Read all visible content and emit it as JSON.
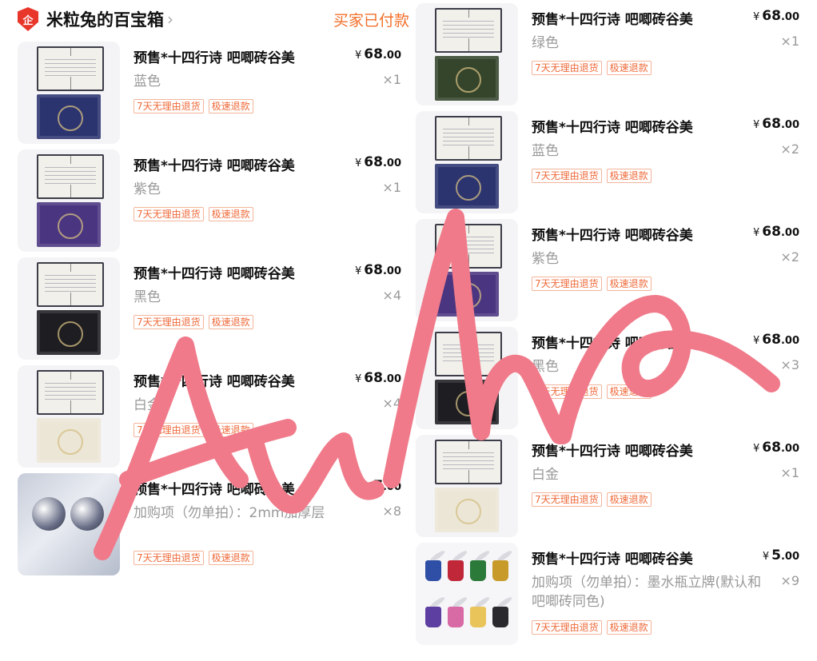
{
  "shop": {
    "badge": "企",
    "name": "米粒兔的百宝箱",
    "chevron": "›",
    "status": "买家已付款"
  },
  "currency": "¥",
  "tags": [
    "7天无理由退货",
    "极速退款"
  ],
  "colors": {
    "accent": "#f2702c",
    "tag_border": "#f4b49b",
    "scribble": "#f07a8a"
  },
  "items_left": [
    {
      "title": "预售*十四行诗 吧唧砖谷美",
      "price_int": "68",
      "price_dec": ".00",
      "variant": "蓝色",
      "qty": "×1",
      "thumb": "book",
      "cover_color": "#2c3470"
    },
    {
      "title": "预售*十四行诗 吧唧砖谷美",
      "price_int": "68",
      "price_dec": ".00",
      "variant": "紫色",
      "qty": "×1",
      "thumb": "book",
      "cover_color": "#4a3580"
    },
    {
      "title": "预售*十四行诗 吧唧砖谷美",
      "price_int": "68",
      "price_dec": ".00",
      "variant": "黑色",
      "qty": "×4",
      "thumb": "book",
      "cover_color": "#1d1d22"
    },
    {
      "title": "预售*十四行诗 吧唧砖谷美",
      "price_int": "68",
      "price_dec": ".00",
      "variant": "白金",
      "qty": "×4",
      "thumb": "book",
      "cover_color": "#ece6d6"
    },
    {
      "title": "预售*十四行诗 吧唧砖谷美",
      "price_int": "7",
      "price_dec": ".00",
      "variant": "加购项（勿单拍）：2mm加厚层",
      "qty": "×8",
      "thumb": "photo",
      "cover_color": ""
    }
  ],
  "items_right": [
    {
      "title": "预售*十四行诗 吧唧砖谷美",
      "price_int": "68",
      "price_dec": ".00",
      "variant": "绿色",
      "qty": "×1",
      "thumb": "book",
      "cover_color": "#34452c"
    },
    {
      "title": "预售*十四行诗 吧唧砖谷美",
      "price_int": "68",
      "price_dec": ".00",
      "variant": "蓝色",
      "qty": "×2",
      "thumb": "book",
      "cover_color": "#2c3470"
    },
    {
      "title": "预售*十四行诗 吧唧砖谷美",
      "price_int": "68",
      "price_dec": ".00",
      "variant": "紫色",
      "qty": "×2",
      "thumb": "book",
      "cover_color": "#4a3580"
    },
    {
      "title": "预售*十四行诗 吧唧砖谷美",
      "price_int": "68",
      "price_dec": ".00",
      "variant": "黑色",
      "qty": "×3",
      "thumb": "book",
      "cover_color": "#1d1d22"
    },
    {
      "title": "预售*十四行诗 吧唧砖谷美",
      "price_int": "68",
      "price_dec": ".00",
      "variant": "白金",
      "qty": "×1",
      "thumb": "book",
      "cover_color": "#ece6d6"
    },
    {
      "title": "预售*十四行诗 吧唧砖谷美",
      "price_int": "5",
      "price_dec": ".00",
      "variant": "加购项（勿单拍）：墨水瓶立牌(默认和吧唧砖同色)",
      "qty": "×9",
      "thumb": "ink",
      "cover_color": ""
    }
  ],
  "ink_colors": [
    "#2f4fa6",
    "#c0283a",
    "#2c7a3a",
    "#c79a2a",
    "#5c3fa0",
    "#d86aa6",
    "#e8c45a",
    "#2a2a2e"
  ],
  "icons": {
    "badge": "shield-badge-icon",
    "chevron": "chevron-right-icon"
  }
}
